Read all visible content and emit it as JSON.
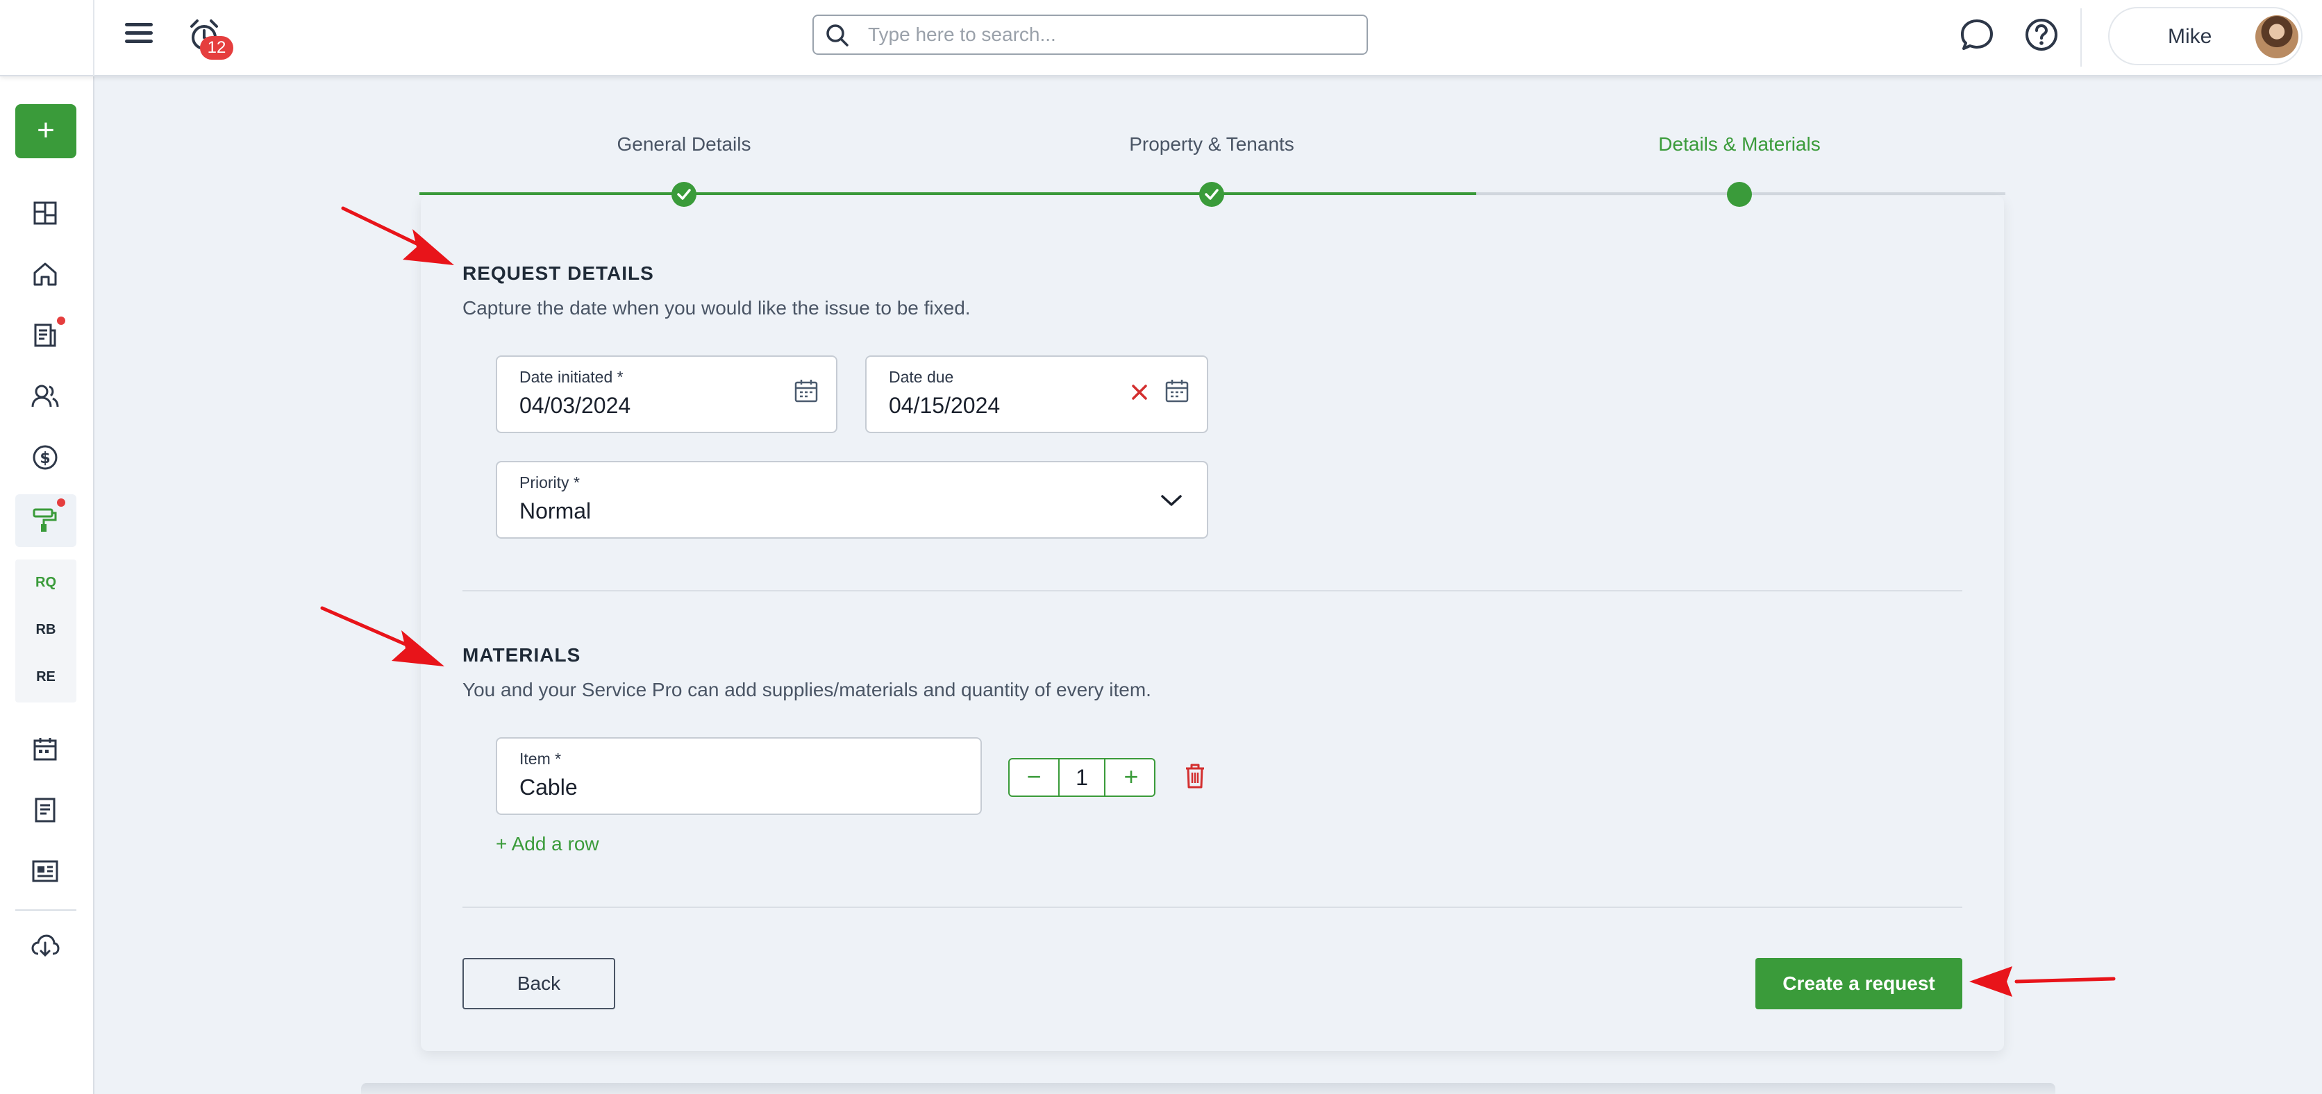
{
  "topbar": {
    "notification_count": "12",
    "search_placeholder": "Type here to search...",
    "user_name": "Mike"
  },
  "sidebar": {
    "add_label": "+",
    "icons": [
      "dashboard-icon",
      "home-icon",
      "documents-icon",
      "people-icon",
      "dollar-icon",
      "paint-roller-icon",
      "calendar-icon",
      "notes-icon",
      "id-card-icon",
      "download-icon"
    ],
    "sub_items": [
      "RQ",
      "RB",
      "RE"
    ]
  },
  "stepper": {
    "steps": [
      {
        "label": "General Details",
        "state": "completed"
      },
      {
        "label": "Property & Tenants",
        "state": "completed"
      },
      {
        "label": "Details & Materials",
        "state": "active"
      }
    ]
  },
  "request_details": {
    "title": "REQUEST DETAILS",
    "description": "Capture the date when you would like the issue to be fixed.",
    "date_initiated": {
      "label": "Date initiated *",
      "value": "04/03/2024"
    },
    "date_due": {
      "label": "Date due",
      "value": "04/15/2024"
    },
    "priority": {
      "label": "Priority *",
      "value": "Normal"
    }
  },
  "materials": {
    "title": "MATERIALS",
    "description": "You and your Service Pro can add supplies/materials and quantity of every item.",
    "items": [
      {
        "label": "Item *",
        "value": "Cable",
        "quantity": "1"
      }
    ],
    "decrement_label": "−",
    "increment_label": "+",
    "add_row_label": "+ Add a row"
  },
  "actions": {
    "back_label": "Back",
    "create_label": "Create a request"
  },
  "colors": {
    "accent": "#3a9b3a",
    "danger": "#e53e3e",
    "annotation_arrow": "#e8141a",
    "background": "#eef2f7"
  }
}
